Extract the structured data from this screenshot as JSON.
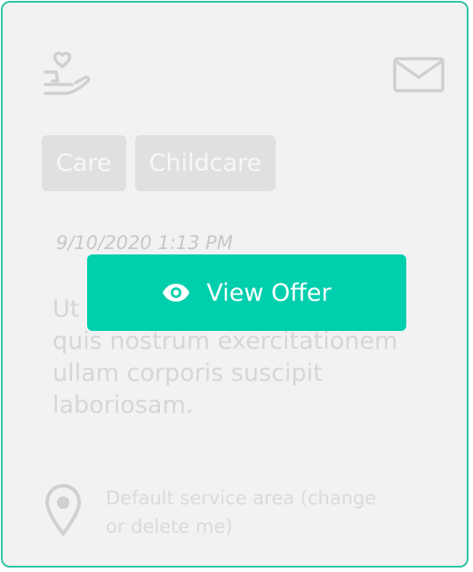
{
  "card": {
    "tags": [
      "Care",
      "Childcare"
    ],
    "timestamp": "9/10/2020 1:13 PM",
    "description": "Ut enim ad minima veniam, quis nostrum exercitationem ullam corporis suscipit laboriosam.",
    "location": {
      "text": "Default service area (change or delete me)"
    },
    "overlay_button": {
      "label": "View Offer",
      "icon": "eye-icon"
    },
    "icons": {
      "offer": "hand-heart-icon",
      "message": "mail-icon",
      "location": "map-pin-icon"
    }
  },
  "colors": {
    "accent": "#00cfae",
    "border": "#2ec4a6",
    "card_background": "#f2f2f2",
    "muted": "#d0d0d0"
  }
}
